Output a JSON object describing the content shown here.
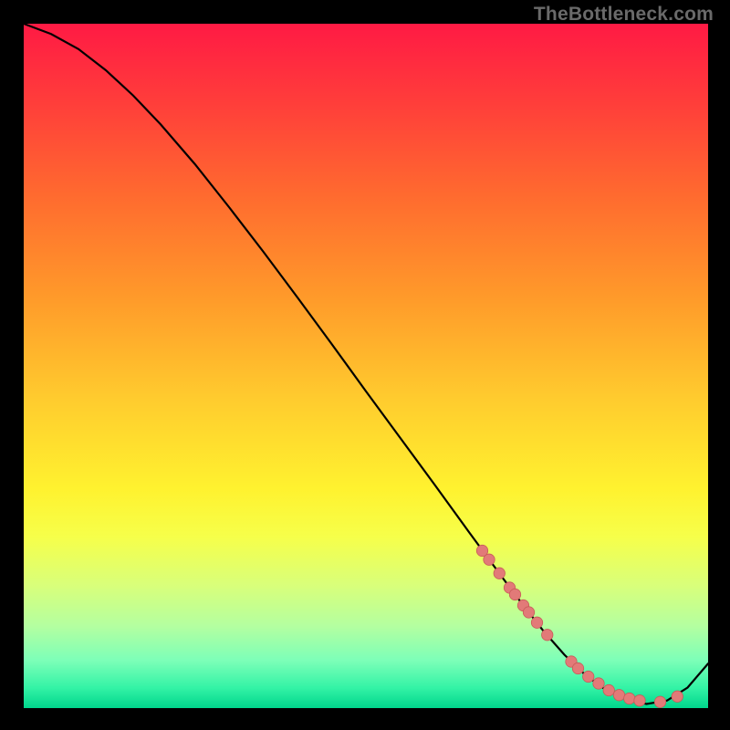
{
  "watermark": "TheBottleneck.com",
  "colors": {
    "curve": "#000000",
    "marker_fill": "#e27a78",
    "marker_stroke": "#c85a58"
  },
  "chart_data": {
    "type": "line",
    "title": "",
    "xlabel": "",
    "ylabel": "",
    "xlim": [
      0,
      100
    ],
    "ylim": [
      0,
      100
    ],
    "series": [
      {
        "name": "bottleneck-curve",
        "x": [
          0,
          4,
          8,
          12,
          16,
          20,
          25,
          30,
          35,
          40,
          45,
          50,
          55,
          60,
          65,
          70,
          73,
          76,
          79,
          82,
          85,
          88,
          91,
          94,
          97,
          100
        ],
        "y": [
          100,
          98.5,
          96.3,
          93.2,
          89.5,
          85.3,
          79.5,
          73.2,
          66.7,
          60.0,
          53.2,
          46.3,
          39.5,
          32.7,
          25.8,
          19.0,
          15.0,
          11.2,
          7.8,
          4.9,
          2.7,
          1.3,
          0.6,
          1.1,
          3.0,
          6.5
        ]
      },
      {
        "name": "markers",
        "x": [
          68.0,
          67.0,
          69.5,
          71.0,
          71.8,
          73.0,
          73.8,
          75.0,
          76.5,
          80.0,
          81.0,
          82.5,
          84.0,
          85.5,
          87.0,
          88.5,
          90.0,
          93.0,
          95.5
        ],
        "y": [
          21.7,
          23.0,
          19.7,
          17.6,
          16.6,
          15.0,
          14.0,
          12.5,
          10.7,
          6.8,
          5.8,
          4.6,
          3.6,
          2.6,
          1.9,
          1.4,
          1.1,
          0.9,
          1.7
        ]
      }
    ]
  }
}
